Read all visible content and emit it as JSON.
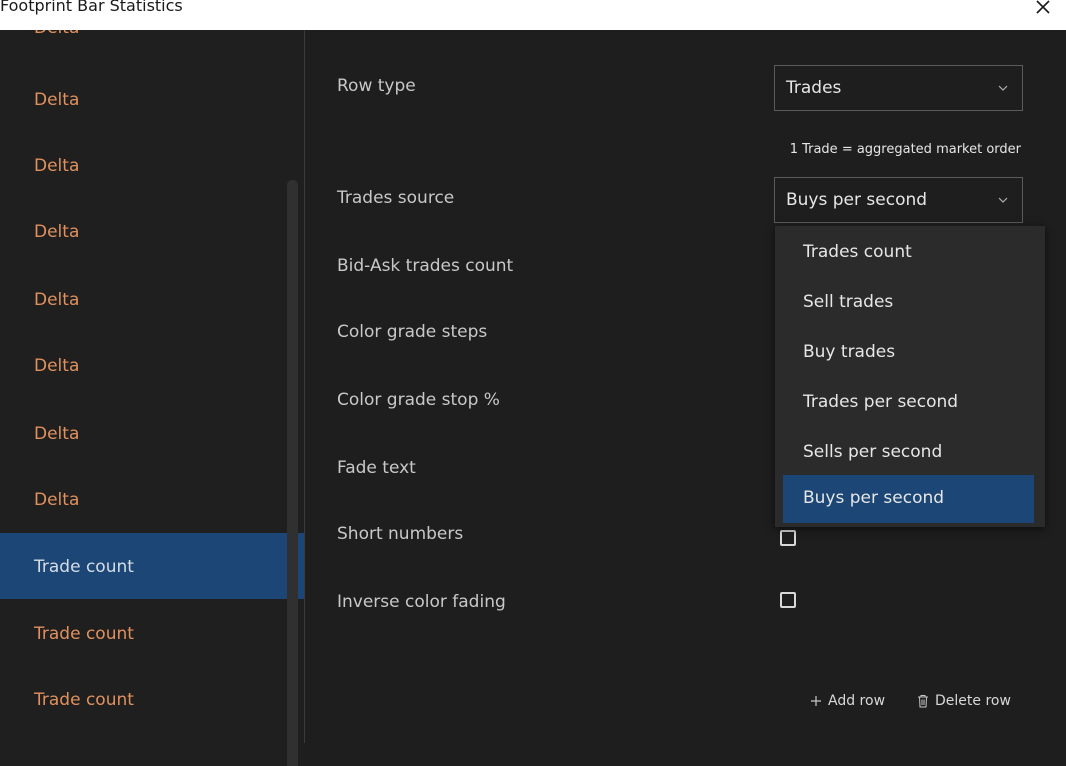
{
  "window": {
    "title": "Footprint Bar Statistics"
  },
  "sidebar": {
    "partial_item": "Delta",
    "items": [
      {
        "label": "Delta"
      },
      {
        "label": "Delta"
      },
      {
        "label": "Delta"
      },
      {
        "label": "Delta"
      },
      {
        "label": "Delta"
      },
      {
        "label": "Delta"
      },
      {
        "label": "Delta"
      },
      {
        "label": "Trade count",
        "active": true
      },
      {
        "label": "Trade count"
      },
      {
        "label": "Trade count"
      }
    ]
  },
  "settings": {
    "row_type": {
      "label": "Row type",
      "value": "Trades"
    },
    "hint": "1 Trade = aggregated market order",
    "trades_source": {
      "label": "Trades source",
      "value": "Buys per second"
    },
    "bid_ask": {
      "label": "Bid-Ask trades count"
    },
    "color_grade_steps": {
      "label": "Color grade steps"
    },
    "color_grade_stop": {
      "label": "Color grade stop %"
    },
    "fade_text": {
      "label": "Fade text"
    },
    "short_numbers": {
      "label": "Short numbers",
      "checked": false
    },
    "inverse_color_fading": {
      "label": "Inverse color fading",
      "checked": false
    }
  },
  "dropdown": {
    "options": [
      "Trades count",
      "Sell trades",
      "Buy trades",
      "Trades per second",
      "Sells per second",
      "Buys per second"
    ],
    "selected": "Buys per second"
  },
  "footer": {
    "add_row": "Add row",
    "delete_row": "Delete row"
  },
  "icons": {
    "close": "close-icon",
    "chevron": "chevron-down-icon",
    "add": "plus-icon",
    "delete": "trash-icon"
  },
  "colors": {
    "accent_selected": "#1b4675",
    "sidebar_text": "#e0915e",
    "background": "#1e1e1e"
  }
}
